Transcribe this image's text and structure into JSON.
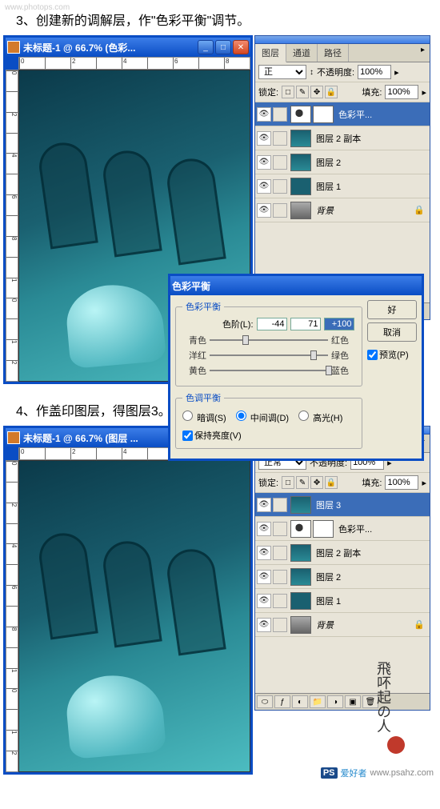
{
  "watermark": "www.photops.com",
  "caption1": "3、创建新的调解层，作\"色彩平衡\"调节。",
  "caption2": "4、作盖印图层，得图层3。",
  "win1": {
    "title": "未标题-1 @ 66.7% (色彩..."
  },
  "win2": {
    "title": "未标题-1 @ 66.7% (图层 ..."
  },
  "ruler_h": [
    "0",
    "",
    "2",
    "",
    "4",
    "",
    "6",
    "",
    "8"
  ],
  "ruler_v": [
    "0",
    "",
    "2",
    "",
    "4",
    "",
    "6",
    "",
    "8",
    "",
    "1",
    "0",
    "",
    "1",
    "2"
  ],
  "panel": {
    "tabs": [
      "图层",
      "通道",
      "路径"
    ],
    "blend_row": {
      "label_opacity": "不透明度:",
      "opacity": "100%",
      "label_fill": "填充:",
      "fill": "100%",
      "lock_label": "锁定:"
    },
    "blend1": "正",
    "blend2": "正常",
    "layers1": [
      {
        "name": "色彩平...",
        "type": "adj",
        "sel": true
      },
      {
        "name": "图层 2 副本",
        "type": "teal"
      },
      {
        "name": "图层 2",
        "type": "teal"
      },
      {
        "name": "图层 1",
        "type": "solid"
      },
      {
        "name": "背景",
        "type": "bg",
        "italic": true
      }
    ],
    "layers2": [
      {
        "name": "图层 3",
        "type": "teal",
        "sel": true
      },
      {
        "name": "色彩平...",
        "type": "adj"
      },
      {
        "name": "图层 2 副本",
        "type": "teal"
      },
      {
        "name": "图层 2",
        "type": "teal"
      },
      {
        "name": "图层 1",
        "type": "solid"
      },
      {
        "name": "背景",
        "type": "bg",
        "italic": true
      }
    ]
  },
  "dialog": {
    "title": "色彩平衡",
    "group1": "色彩平衡",
    "levels_label": "色阶(L):",
    "values": [
      "-44",
      "71",
      "+100"
    ],
    "sliders": [
      {
        "left": "青色",
        "right": "红色",
        "pos": 28
      },
      {
        "left": "洋红",
        "right": "绿色",
        "pos": 85
      },
      {
        "left": "黄色",
        "right": "蓝色",
        "pos": 98
      }
    ],
    "group2": "色调平衡",
    "radios": [
      "暗调(S)",
      "中间调(D)",
      "高光(H)"
    ],
    "preserve": "保持亮度(V)",
    "btn_ok": "好",
    "btn_cancel": "取消",
    "preview": "预览(P)"
  },
  "sig_text": "飛吥起の人",
  "footer_wm": {
    "ps": "PS",
    "text": "爱好者",
    "url": "www.psahz.com"
  }
}
